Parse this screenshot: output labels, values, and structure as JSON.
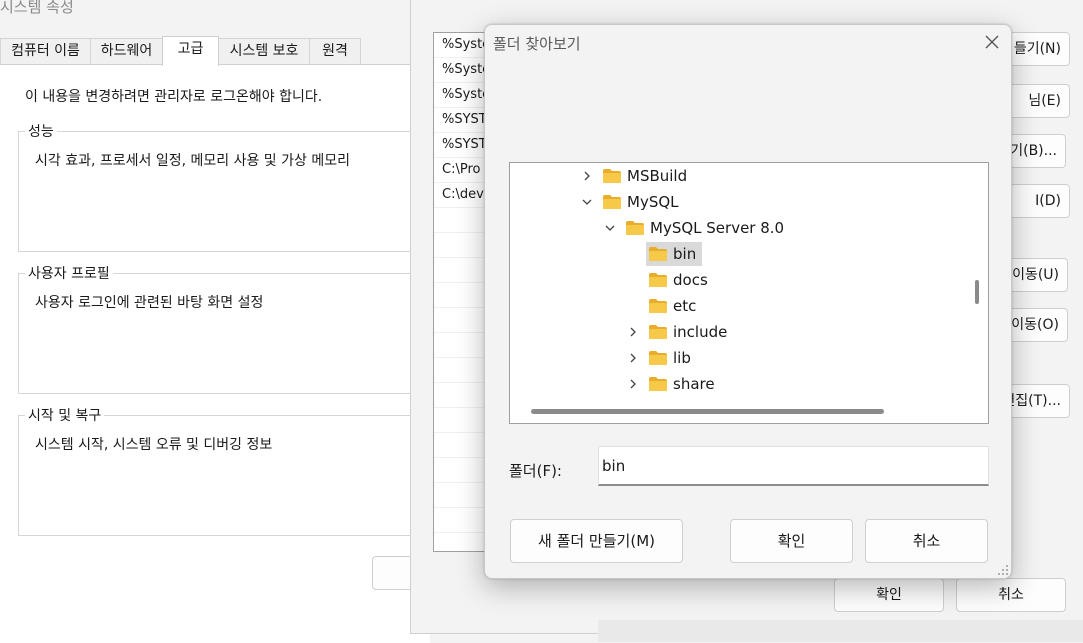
{
  "system_properties": {
    "title": "시스템 속성",
    "tabs": [
      {
        "label": "컴퓨터 이름",
        "active": false
      },
      {
        "label": "하드웨어",
        "active": false
      },
      {
        "label": "고급",
        "active": true
      },
      {
        "label": "시스템 보호",
        "active": false
      },
      {
        "label": "원격",
        "active": false
      }
    ],
    "admin_note": "이 내용을 변경하려면 관리자로 로그온해야 합니다.",
    "groups": [
      {
        "label": "성능",
        "description": "시각 효과, 프로세서 일정, 메모리 사용 및 가상 메모리"
      },
      {
        "label": "사용자 프로필",
        "description": "사용자 로그인에 관련된 바탕 화면 설정"
      },
      {
        "label": "시작 및 복구",
        "description": "시스템 시작, 시스템 오류 및 디버깅 정보"
      }
    ]
  },
  "env_window": {
    "list_rows": [
      "%Syste",
      "%Syste",
      "%Syste",
      "%SYST",
      "%SYST",
      "C:\\Pro",
      "C:\\dev",
      "",
      "",
      "",
      "",
      "",
      "",
      "",
      "",
      "",
      "",
      "",
      "",
      "",
      ""
    ],
    "side_buttons": [
      "들기(N)",
      "님(E)",
      "기(B)...",
      "I(D)",
      "이동(U)",
      "이동(O)",
      "편집(T)..."
    ],
    "ok_label": "확인",
    "cancel_label": "취소"
  },
  "browse_dialog": {
    "title": "폴더 찾아보기",
    "tree": [
      {
        "label": "MSBuild",
        "expander": "collapsed",
        "selected": false
      },
      {
        "label": "MySQL",
        "expander": "expanded",
        "selected": false
      },
      {
        "label": "MySQL Server 8.0",
        "expander": "expanded",
        "selected": false
      },
      {
        "label": "bin",
        "expander": "none",
        "selected": true
      },
      {
        "label": "docs",
        "expander": "none",
        "selected": false
      },
      {
        "label": "etc",
        "expander": "none",
        "selected": false
      },
      {
        "label": "include",
        "expander": "collapsed",
        "selected": false
      },
      {
        "label": "lib",
        "expander": "collapsed",
        "selected": false
      },
      {
        "label": "share",
        "expander": "collapsed",
        "selected": false
      }
    ],
    "folder_label": "폴더(F):",
    "folder_value": "bin",
    "new_folder_label": "새 폴더 만들기(M)",
    "ok_label": "확인",
    "cancel_label": "취소"
  },
  "colors": {
    "folder": "#f7c948",
    "folder_tab": "#e9ad2a",
    "selection": "#d9d9d9"
  }
}
